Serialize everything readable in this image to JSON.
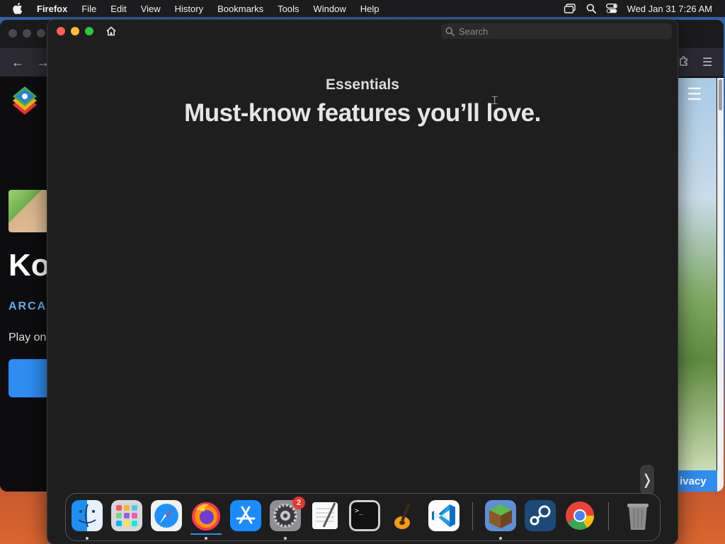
{
  "menubar": {
    "app": "Firefox",
    "items": [
      "File",
      "Edit",
      "View",
      "History",
      "Bookmarks",
      "Tools",
      "Window",
      "Help"
    ],
    "clock": "Wed Jan 31  7:26 AM"
  },
  "background_page": {
    "heading_fragment": "Ko",
    "category_fragment": "ARCAI",
    "text_fragment": "Play on",
    "privacy_fragment": "ivacy"
  },
  "window": {
    "search_placeholder": "Search",
    "kicker": "Essentials",
    "headline": "Must-know features you’ll love.",
    "next_glyph": "❭"
  },
  "dock": {
    "apps": [
      "finder",
      "launchpad",
      "safari",
      "firefox",
      "app-store",
      "system-settings",
      "textedit",
      "terminal",
      "garageband",
      "vscode",
      "minecraft",
      "steam",
      "chrome",
      "trash"
    ],
    "system_settings_badge": "2"
  },
  "colors": {
    "accent": "#2f8cf0",
    "badge": "#e8352e",
    "traffic_close": "#ff5f57",
    "traffic_min": "#febc2e",
    "traffic_max": "#28c840"
  }
}
